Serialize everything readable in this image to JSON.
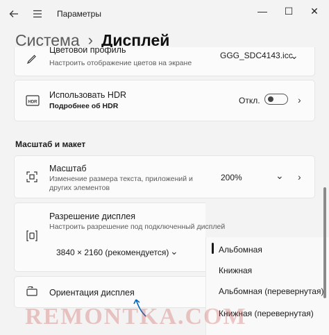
{
  "window": {
    "title": "Параметры",
    "back_icon": "back-arrow-icon",
    "menu_icon": "hamburger-icon",
    "minimize": "—",
    "maximize": "☐",
    "close": "✕"
  },
  "breadcrumb": {
    "parent": "Система",
    "separator": "›",
    "current": "Дисплей"
  },
  "color_profile": {
    "title": "Цветовой профиль",
    "subtitle": "Настроить отображение цветов на экране",
    "value": "GGG_SDC4143.icc"
  },
  "hdr": {
    "title": "Использовать HDR",
    "link": "Подробнее об HDR",
    "toggle_label": "Откл.",
    "toggle_state": "off"
  },
  "section": {
    "scale_layout": "Масштаб и макет"
  },
  "scale": {
    "title": "Масштаб",
    "subtitle": "Изменение размера текста, приложений и других элементов",
    "value": "200%"
  },
  "resolution": {
    "title": "Разрешение дисплея",
    "subtitle": "Настроить разрешение под подключенный дисплей",
    "value": "3840 × 2160 (рекомендуется)"
  },
  "orientation": {
    "title": "Ориентация дисплея",
    "options": [
      "Альбомная",
      "Книжная",
      "Альбомная (перевернутая)",
      "Книжная (перевернутая)"
    ],
    "selected": "Альбомная"
  },
  "watermark": "REMONTKA.COM",
  "colors": {
    "accent": "#0067c0",
    "background": "#f3f3f3",
    "card": "#fbfbfb"
  }
}
